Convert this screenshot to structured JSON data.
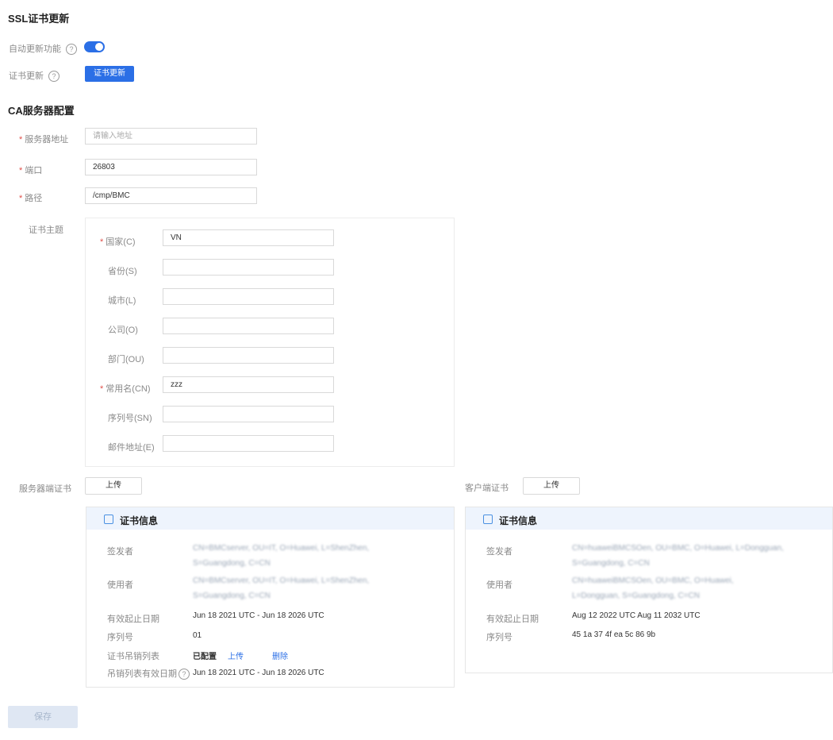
{
  "ssl": {
    "title": "SSL证书更新",
    "auto_update_label": "自动更新功能",
    "cert_update_label": "证书更新",
    "cert_update_button": "证书更新",
    "toggle_on": true
  },
  "ca": {
    "title": "CA服务器配置",
    "server_addr_label": "服务器地址",
    "server_addr_placeholder": "请输入地址",
    "port_label": "端口",
    "port_value": "26803",
    "path_label": "路径",
    "path_value": "/cmp/BMC",
    "subject_label": "证书主题"
  },
  "subject": {
    "country_label": "国家(C)",
    "country_value": "VN",
    "state_label": "省份(S)",
    "city_label": "城市(L)",
    "org_label": "公司(O)",
    "unit_label": "部门(OU)",
    "cn_label": "常用名(CN)",
    "cn_value": "zzz",
    "serial_label": "序列号(SN)",
    "email_label": "邮件地址(E)"
  },
  "server_cert": {
    "label": "服务器端证书",
    "upload_button": "上传",
    "card_title": "证书信息",
    "issuer_label": "签发者",
    "issuer_line1": "CN=BMCserver, OU=IT, O=Huawei, L=ShenZhen,",
    "issuer_line2": "S=Guangdong, C=CN",
    "subject_label": "使用者",
    "subject_line1": "CN=BMCserver, OU=IT, O=Huawei, L=ShenZhen,",
    "subject_line2": "S=Guangdong, C=CN",
    "validity_label": "有效起止日期",
    "validity_value": "Jun 18 2021 UTC - Jun 18 2026 UTC",
    "serial_label": "序列号",
    "serial_value": "01",
    "revocation_label": "证书吊销列表",
    "revocation_status": "已配置",
    "revocation_upload": "上传",
    "revocation_delete": "删除",
    "crl_validity_label": "吊销列表有效日期",
    "crl_validity_value": "Jun 18 2021 UTC - Jun 18 2026 UTC"
  },
  "client_cert": {
    "label": "客户端证书",
    "upload_button": "上传",
    "card_title": "证书信息",
    "issuer_label": "签发者",
    "issuer_line1": "CN=huaweiBMCSOen, OU=BMC, O=Huawei, L=Dongguan,",
    "issuer_line2": "S=Guangdong, C=CN",
    "subject_label": "使用者",
    "subject_line1": "CN=huaweiBMCSOen, OU=BMC, O=Huawei,",
    "subject_line2": "L=Dongguan, S=Guangdong, C=CN",
    "validity_label": "有效起止日期",
    "validity_value": "Aug 12 2022 UTC Aug 11 2032 UTC",
    "serial_label": "序列号",
    "serial_value": "45 1a 37 4f ea 5c 86 9b"
  },
  "footer": {
    "save_button": "保存"
  },
  "colors": {
    "accent": "#2b6fe6",
    "required": "#e0504a",
    "card_header": "#eef4fd"
  },
  "icons": {
    "help": "question-circle-icon",
    "cert": "certificate-icon"
  }
}
